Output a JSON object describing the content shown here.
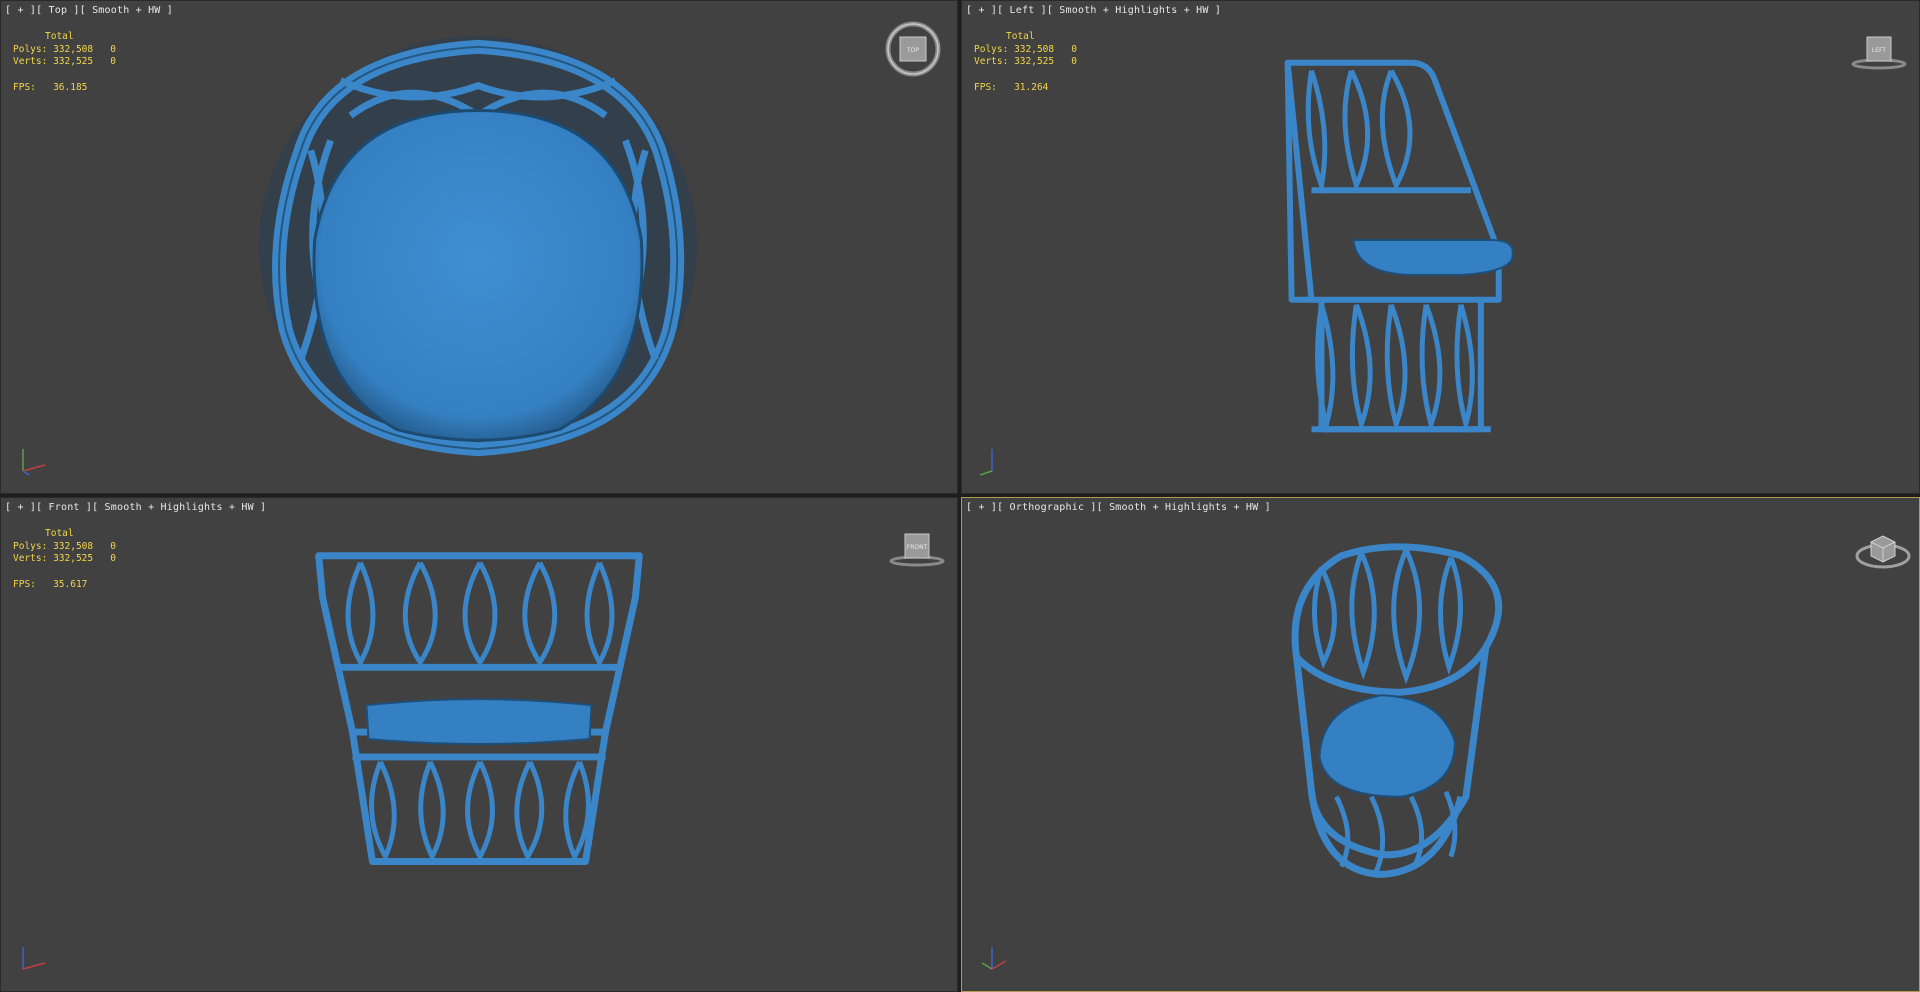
{
  "viewports": {
    "top": {
      "label": "[ + ][ Top ][ Smooth + HW ]",
      "stats_header": "Total",
      "polys_label": "Polys:",
      "polys_value": "332,508",
      "polys_sel": "0",
      "verts_label": "Verts:",
      "verts_value": "332,525",
      "verts_sel": "0",
      "fps_label": "FPS:",
      "fps_value": "36.185"
    },
    "left": {
      "label": "[ + ][ Left ][ Smooth + Highlights + HW ]",
      "stats_header": "Total",
      "polys_label": "Polys:",
      "polys_value": "332,508",
      "polys_sel": "0",
      "verts_label": "Verts:",
      "verts_value": "332,525",
      "verts_sel": "0",
      "fps_label": "FPS:",
      "fps_value": "31.264"
    },
    "front": {
      "label": "[ + ][ Front ][ Smooth + Highlights + HW ]",
      "stats_header": "Total",
      "polys_label": "Polys:",
      "polys_value": "332,508",
      "polys_sel": "0",
      "verts_label": "Verts:",
      "verts_value": "332,525",
      "verts_sel": "0",
      "fps_label": "FPS:",
      "fps_value": "35.617"
    },
    "perspective": {
      "label": "[ + ][ Orthographic ][ Smooth + Highlights + HW ]"
    }
  },
  "viewcube_faces": {
    "top": "TOP",
    "left": "LEFT",
    "front": "FRONT"
  },
  "colors": {
    "viewport_bg": "#414141",
    "model": "#3a86c8",
    "stats_text": "#f2d64a",
    "active_border": "#b89a4e"
  },
  "icons": [
    "viewcube-icon",
    "axis-gizmo-icon"
  ]
}
